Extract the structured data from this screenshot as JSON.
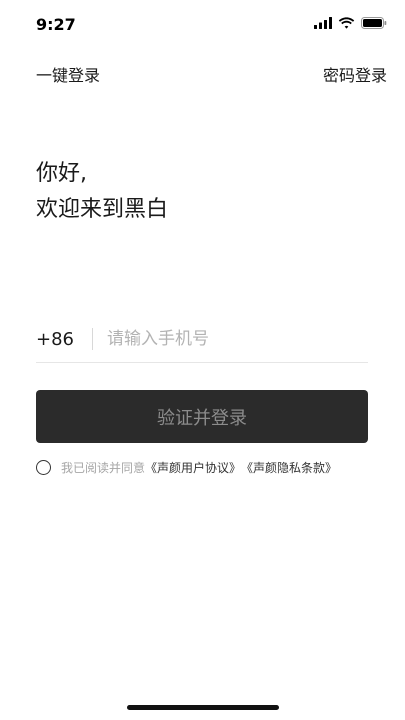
{
  "status_bar": {
    "time": "9:27",
    "icons": [
      "signal-icon",
      "wifi-icon",
      "battery-icon"
    ]
  },
  "header": {
    "one_click_login": "一键登录",
    "password_login": "密码登录"
  },
  "greeting": {
    "line1": "你好,",
    "line2": "欢迎来到黑白"
  },
  "phone": {
    "country_code": "+86",
    "value": "",
    "placeholder": "请输入手机号"
  },
  "login_button": {
    "label": "验证并登录",
    "state": "disabled"
  },
  "agreement": {
    "checked": false,
    "prefix": "我已阅读并同意",
    "user_agreement": "《声颜用户协议》",
    "privacy_terms": "《声颜隐私条款》"
  },
  "colors": {
    "button_bg": "#2b2b2b",
    "button_text": "#8c8c8c",
    "placeholder": "#b3b3b3",
    "muted_text": "#a6a6a6"
  }
}
